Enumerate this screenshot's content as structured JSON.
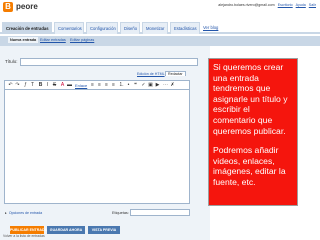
{
  "header": {
    "blog_name": "peore",
    "logo_glyph": "B",
    "user_email": "alejandro.bolaes.rivero@gmail.com",
    "links": [
      "Escritorio",
      "Ayuda",
      "Salir"
    ]
  },
  "tabs": [
    {
      "label": "Creación de entradas",
      "active": true
    },
    {
      "label": "Comentarios",
      "active": false
    },
    {
      "label": "Configuración",
      "active": false
    },
    {
      "label": "Diseño",
      "active": false
    },
    {
      "label": "Monetizar",
      "active": false
    },
    {
      "label": "Estadísticas",
      "active": false
    },
    {
      "label": "Ver blog",
      "active": false
    }
  ],
  "subtabs": [
    {
      "label": "Nueva entrada",
      "active": true
    },
    {
      "label": "Editar entradas",
      "active": false
    },
    {
      "label": "Editar páginas",
      "active": false
    }
  ],
  "editor": {
    "title_label": "Título:",
    "title_value": "",
    "mode_html": "Edición de HTML",
    "mode_compose": "Redactar",
    "link_label": "Enlace",
    "post_options_label": "Opciones de entrada",
    "labels_label": "Etiquetas:",
    "labels_value": ""
  },
  "buttons": {
    "publish": "PUBLICAR ENTRADA",
    "save": "GUARDAR AHORA",
    "preview": "VISTA PREVIA"
  },
  "footer": {
    "text": "Volver a la lista de entradas"
  },
  "note": {
    "paragraph1": "Si queremos crear una entrada tendremos que asignarle un título y escribir el comentario que queremos publicar.",
    "paragraph2": "Podremos añadir videos, enlaces, imágenes, editar la fuente, etc."
  },
  "colors": {
    "accent": "#f57d00",
    "note_bg": "#f5150d",
    "tab_bg": "#c9d7e6"
  }
}
